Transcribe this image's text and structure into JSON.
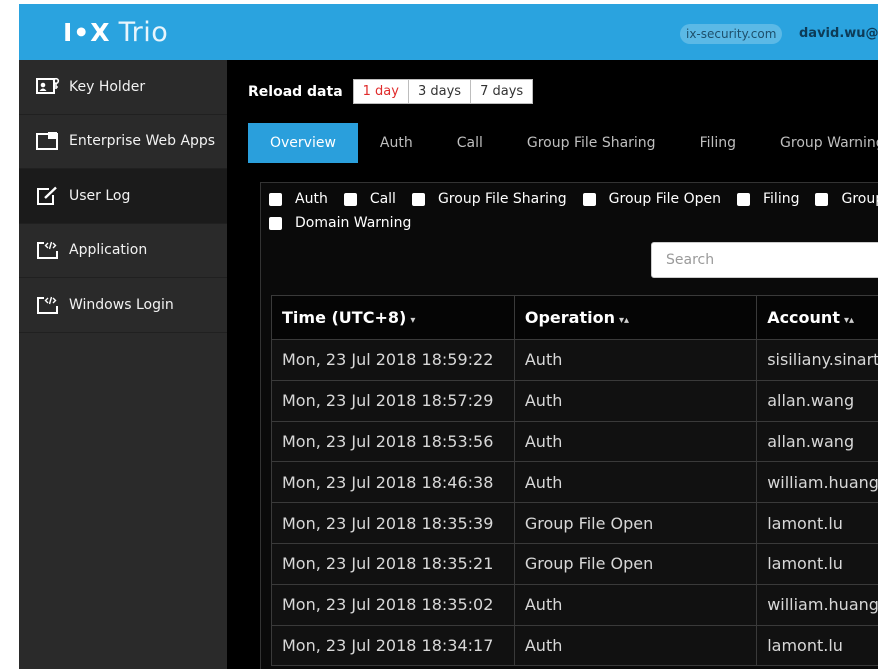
{
  "header": {
    "logo_mark": "I•X",
    "logo_text": "Trio",
    "domain": "ix-security.com",
    "user": "david.wu@ix"
  },
  "sidebar": {
    "items": [
      {
        "label": "Key Holder",
        "icon": "key-holder-icon"
      },
      {
        "label": "Enterprise Web Apps",
        "icon": "web-apps-icon"
      },
      {
        "label": "User Log",
        "icon": "edit-log-icon"
      },
      {
        "label": "Application",
        "icon": "code-window-icon"
      },
      {
        "label": "Windows Login",
        "icon": "code-window-icon"
      }
    ],
    "active_index": 2
  },
  "reload": {
    "label": "Reload data",
    "options": [
      "1 day",
      "3 days",
      "7 days"
    ],
    "selected": "1 day"
  },
  "tabs": [
    "Overview",
    "Auth",
    "Call",
    "Group File Sharing",
    "Filing",
    "Group Warning"
  ],
  "active_tab": "Overview",
  "filters": {
    "row1": [
      "Auth",
      "Call",
      "Group File Sharing",
      "Group File Open",
      "Filing",
      "Group"
    ],
    "row2": [
      "Domain Warning"
    ]
  },
  "search": {
    "placeholder": "Search"
  },
  "table": {
    "headers": [
      "Time (UTC+8)",
      "Operation",
      "Account"
    ],
    "rows": [
      [
        "Mon, 23 Jul 2018 18:59:22",
        "Auth",
        "sisiliany.sinart"
      ],
      [
        "Mon, 23 Jul 2018 18:57:29",
        "Auth",
        "allan.wang"
      ],
      [
        "Mon, 23 Jul 2018 18:53:56",
        "Auth",
        "allan.wang"
      ],
      [
        "Mon, 23 Jul 2018 18:46:38",
        "Auth",
        "william.huang"
      ],
      [
        "Mon, 23 Jul 2018 18:35:39",
        "Group File Open",
        "lamont.lu"
      ],
      [
        "Mon, 23 Jul 2018 18:35:21",
        "Group File Open",
        "lamont.lu"
      ],
      [
        "Mon, 23 Jul 2018 18:35:02",
        "Auth",
        "william.huang"
      ],
      [
        "Mon, 23 Jul 2018 18:34:17",
        "Auth",
        "lamont.lu"
      ]
    ]
  },
  "colors": {
    "header_bg": "#2aa3df",
    "active_tab": "#2a9fdc",
    "selected_range": "#e02b2b"
  }
}
